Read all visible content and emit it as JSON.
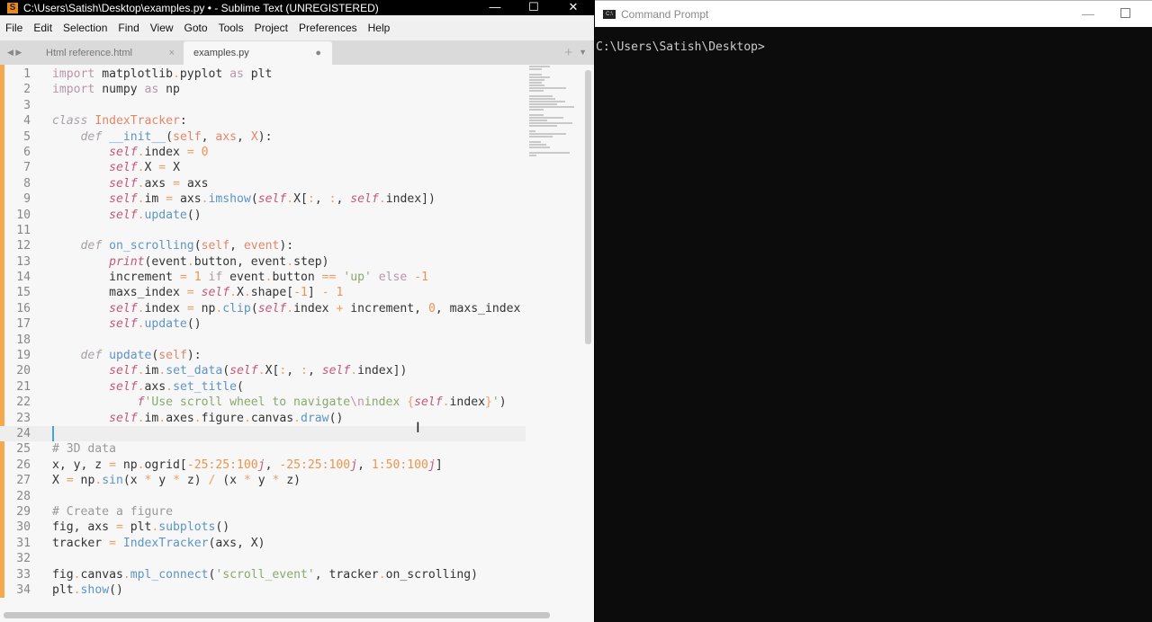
{
  "sublime": {
    "title": "C:\\Users\\Satish\\Desktop\\examples.py • - Sublime Text (UNREGISTERED)",
    "window_buttons": {
      "minimize": "—",
      "maximize": "☐",
      "close": "✕"
    },
    "menu": [
      "File",
      "Edit",
      "Selection",
      "Find",
      "View",
      "Goto",
      "Tools",
      "Project",
      "Preferences",
      "Help"
    ],
    "tabs": [
      {
        "label": "Html reference.html",
        "close": "×"
      },
      {
        "label": "examples.py",
        "dirty": "●"
      }
    ],
    "tab_nav": "◀ ▶",
    "tab_add": "+",
    "tab_menu": "▼",
    "current_line": 24,
    "code": [
      [
        [
          "k",
          "import"
        ],
        [
          "p",
          " matplotlib"
        ],
        [
          "o",
          "."
        ],
        [
          "p",
          "pyplot "
        ],
        [
          "k",
          "as"
        ],
        [
          "p",
          " plt"
        ]
      ],
      [
        [
          "k",
          "import"
        ],
        [
          "p",
          " numpy "
        ],
        [
          "k",
          "as"
        ],
        [
          "p",
          " np"
        ]
      ],
      [],
      [
        [
          "ki",
          "class"
        ],
        [
          "p",
          " "
        ],
        [
          "cl",
          "IndexTracker"
        ],
        [
          "p",
          ":"
        ]
      ],
      [
        [
          "p",
          "    "
        ],
        [
          "ki",
          "def"
        ],
        [
          "p",
          " "
        ],
        [
          "f",
          "__init__"
        ],
        [
          "p",
          "("
        ],
        [
          "cl",
          "self"
        ],
        [
          "p",
          ", "
        ],
        [
          "cl",
          "axs"
        ],
        [
          "p",
          ", "
        ],
        [
          "cl",
          "X"
        ],
        [
          "p",
          "):"
        ]
      ],
      [
        [
          "p",
          "        "
        ],
        [
          "s",
          "self"
        ],
        [
          "o",
          "."
        ],
        [
          "p",
          "index "
        ],
        [
          "o",
          "="
        ],
        [
          "p",
          " "
        ],
        [
          "n",
          "0"
        ]
      ],
      [
        [
          "p",
          "        "
        ],
        [
          "s",
          "self"
        ],
        [
          "o",
          "."
        ],
        [
          "p",
          "X "
        ],
        [
          "o",
          "="
        ],
        [
          "p",
          " X"
        ]
      ],
      [
        [
          "p",
          "        "
        ],
        [
          "s",
          "self"
        ],
        [
          "o",
          "."
        ],
        [
          "p",
          "axs "
        ],
        [
          "o",
          "="
        ],
        [
          "p",
          " axs"
        ]
      ],
      [
        [
          "p",
          "        "
        ],
        [
          "s",
          "self"
        ],
        [
          "o",
          "."
        ],
        [
          "p",
          "im "
        ],
        [
          "o",
          "="
        ],
        [
          "p",
          " axs"
        ],
        [
          "o",
          "."
        ],
        [
          "f",
          "imshow"
        ],
        [
          "p",
          "("
        ],
        [
          "s",
          "self"
        ],
        [
          "o",
          "."
        ],
        [
          "p",
          "X["
        ],
        [
          "o",
          ":"
        ],
        [
          "p",
          ", "
        ],
        [
          "o",
          ":"
        ],
        [
          "p",
          ", "
        ],
        [
          "s",
          "self"
        ],
        [
          "o",
          "."
        ],
        [
          "p",
          "index])"
        ]
      ],
      [
        [
          "p",
          "        "
        ],
        [
          "s",
          "self"
        ],
        [
          "o",
          "."
        ],
        [
          "f",
          "update"
        ],
        [
          "p",
          "()"
        ]
      ],
      [],
      [
        [
          "p",
          "    "
        ],
        [
          "ki",
          "def"
        ],
        [
          "p",
          " "
        ],
        [
          "f",
          "on_scrolling"
        ],
        [
          "p",
          "("
        ],
        [
          "cl",
          "self"
        ],
        [
          "p",
          ", "
        ],
        [
          "cl",
          "event"
        ],
        [
          "p",
          "):"
        ]
      ],
      [
        [
          "p",
          "        "
        ],
        [
          "s",
          "print"
        ],
        [
          "p",
          "(event"
        ],
        [
          "o",
          "."
        ],
        [
          "p",
          "button, event"
        ],
        [
          "o",
          "."
        ],
        [
          "p",
          "step)"
        ]
      ],
      [
        [
          "p",
          "        increment "
        ],
        [
          "o",
          "="
        ],
        [
          "p",
          " "
        ],
        [
          "n",
          "1"
        ],
        [
          "p",
          " "
        ],
        [
          "k",
          "if"
        ],
        [
          "p",
          " event"
        ],
        [
          "o",
          "."
        ],
        [
          "p",
          "button "
        ],
        [
          "o",
          "=="
        ],
        [
          "p",
          " "
        ],
        [
          "t",
          "'up'"
        ],
        [
          "p",
          " "
        ],
        [
          "k",
          "else"
        ],
        [
          "p",
          " "
        ],
        [
          "n",
          "-1"
        ]
      ],
      [
        [
          "p",
          "        maxs_index "
        ],
        [
          "o",
          "="
        ],
        [
          "p",
          " "
        ],
        [
          "s",
          "self"
        ],
        [
          "o",
          "."
        ],
        [
          "p",
          "X"
        ],
        [
          "o",
          "."
        ],
        [
          "p",
          "shape["
        ],
        [
          "n",
          "-1"
        ],
        [
          "p",
          "] "
        ],
        [
          "o",
          "-"
        ],
        [
          "p",
          " "
        ],
        [
          "n",
          "1"
        ]
      ],
      [
        [
          "p",
          "        "
        ],
        [
          "s",
          "self"
        ],
        [
          "o",
          "."
        ],
        [
          "p",
          "index "
        ],
        [
          "o",
          "="
        ],
        [
          "p",
          " np"
        ],
        [
          "o",
          "."
        ],
        [
          "f",
          "clip"
        ],
        [
          "p",
          "("
        ],
        [
          "s",
          "self"
        ],
        [
          "o",
          "."
        ],
        [
          "p",
          "index "
        ],
        [
          "o",
          "+"
        ],
        [
          "p",
          " increment, "
        ],
        [
          "n",
          "0"
        ],
        [
          "p",
          ", maxs_index"
        ]
      ],
      [
        [
          "p",
          "        "
        ],
        [
          "s",
          "self"
        ],
        [
          "o",
          "."
        ],
        [
          "f",
          "update"
        ],
        [
          "p",
          "()"
        ]
      ],
      [],
      [
        [
          "p",
          "    "
        ],
        [
          "ki",
          "def"
        ],
        [
          "p",
          " "
        ],
        [
          "f",
          "update"
        ],
        [
          "p",
          "("
        ],
        [
          "cl",
          "self"
        ],
        [
          "p",
          "):"
        ]
      ],
      [
        [
          "p",
          "        "
        ],
        [
          "s",
          "self"
        ],
        [
          "o",
          "."
        ],
        [
          "p",
          "im"
        ],
        [
          "o",
          "."
        ],
        [
          "f",
          "set_data"
        ],
        [
          "p",
          "("
        ],
        [
          "s",
          "self"
        ],
        [
          "o",
          "."
        ],
        [
          "p",
          "X["
        ],
        [
          "o",
          ":"
        ],
        [
          "p",
          ", "
        ],
        [
          "o",
          ":"
        ],
        [
          "p",
          ", "
        ],
        [
          "s",
          "self"
        ],
        [
          "o",
          "."
        ],
        [
          "p",
          "index])"
        ]
      ],
      [
        [
          "p",
          "        "
        ],
        [
          "s",
          "self"
        ],
        [
          "o",
          "."
        ],
        [
          "p",
          "axs"
        ],
        [
          "o",
          "."
        ],
        [
          "f",
          "set_title"
        ],
        [
          "p",
          "("
        ]
      ],
      [
        [
          "p",
          "            "
        ],
        [
          "s",
          "f"
        ],
        [
          "t",
          "'Use scroll wheel to navigate"
        ],
        [
          "k",
          "\\n"
        ],
        [
          "t",
          "index "
        ],
        [
          "o",
          "{"
        ],
        [
          "s",
          "self"
        ],
        [
          "o",
          "."
        ],
        [
          "p",
          "index"
        ],
        [
          "o",
          "}"
        ],
        [
          "t",
          "'"
        ],
        [
          "p",
          ")"
        ]
      ],
      [
        [
          "p",
          "        "
        ],
        [
          "s",
          "self"
        ],
        [
          "o",
          "."
        ],
        [
          "p",
          "im"
        ],
        [
          "o",
          "."
        ],
        [
          "p",
          "axes"
        ],
        [
          "o",
          "."
        ],
        [
          "p",
          "figure"
        ],
        [
          "o",
          "."
        ],
        [
          "p",
          "canvas"
        ],
        [
          "o",
          "."
        ],
        [
          "f",
          "draw"
        ],
        [
          "p",
          "()"
        ]
      ],
      [],
      [
        [
          "c",
          "# 3D data"
        ]
      ],
      [
        [
          "p",
          "x, y, z "
        ],
        [
          "o",
          "="
        ],
        [
          "p",
          " np"
        ],
        [
          "o",
          "."
        ],
        [
          "p",
          "ogrid["
        ],
        [
          "n",
          "-25:25:100"
        ],
        [
          "s",
          "j"
        ],
        [
          "p",
          ", "
        ],
        [
          "n",
          "-25:25:100"
        ],
        [
          "s",
          "j"
        ],
        [
          "p",
          ", "
        ],
        [
          "n",
          "1:50:100"
        ],
        [
          "s",
          "j"
        ],
        [
          "p",
          "]"
        ]
      ],
      [
        [
          "p",
          "X "
        ],
        [
          "o",
          "="
        ],
        [
          "p",
          " np"
        ],
        [
          "o",
          "."
        ],
        [
          "f",
          "sin"
        ],
        [
          "p",
          "(x "
        ],
        [
          "o",
          "*"
        ],
        [
          "p",
          " y "
        ],
        [
          "o",
          "*"
        ],
        [
          "p",
          " z) "
        ],
        [
          "o",
          "/"
        ],
        [
          "p",
          " (x "
        ],
        [
          "o",
          "*"
        ],
        [
          "p",
          " y "
        ],
        [
          "o",
          "*"
        ],
        [
          "p",
          " z)"
        ]
      ],
      [],
      [
        [
          "c",
          "# Create a figure"
        ]
      ],
      [
        [
          "p",
          "fig, axs "
        ],
        [
          "o",
          "="
        ],
        [
          "p",
          " plt"
        ],
        [
          "o",
          "."
        ],
        [
          "f",
          "subplots"
        ],
        [
          "p",
          "()"
        ]
      ],
      [
        [
          "p",
          "tracker "
        ],
        [
          "o",
          "="
        ],
        [
          "p",
          " "
        ],
        [
          "f",
          "IndexTracker"
        ],
        [
          "p",
          "(axs, X)"
        ]
      ],
      [],
      [
        [
          "p",
          "fig"
        ],
        [
          "o",
          "."
        ],
        [
          "p",
          "canvas"
        ],
        [
          "o",
          "."
        ],
        [
          "f",
          "mpl_connect"
        ],
        [
          "p",
          "("
        ],
        [
          "t",
          "'scroll_event'"
        ],
        [
          "p",
          ", tracker"
        ],
        [
          "o",
          "."
        ],
        [
          "p",
          "on_scrolling)"
        ]
      ],
      [
        [
          "p",
          "plt"
        ],
        [
          "o",
          "."
        ],
        [
          "f",
          "show"
        ],
        [
          "p",
          "()"
        ]
      ]
    ]
  },
  "cmd": {
    "title": "Command Prompt",
    "icon_text": "C:\\",
    "minimize": "—",
    "prompt": "C:\\Users\\Satish\\Desktop>"
  }
}
